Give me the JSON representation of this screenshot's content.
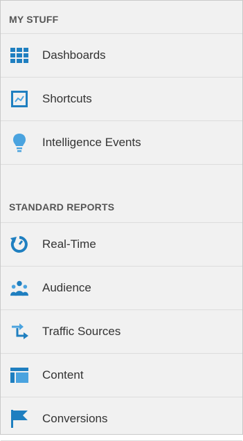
{
  "colors": {
    "accent": "#1f7fc0",
    "icon_light": "#4aa3df"
  },
  "my_stuff": {
    "header": "MY STUFF",
    "items": [
      {
        "label": "Dashboards",
        "icon": "dashboard-grid-icon"
      },
      {
        "label": "Shortcuts",
        "icon": "shortcut-icon"
      },
      {
        "label": "Intelligence Events",
        "icon": "lightbulb-icon"
      }
    ]
  },
  "standard_reports": {
    "header": "STANDARD REPORTS",
    "items": [
      {
        "label": "Real-Time",
        "icon": "realtime-clock-icon"
      },
      {
        "label": "Audience",
        "icon": "audience-people-icon"
      },
      {
        "label": "Traffic Sources",
        "icon": "traffic-arrows-icon"
      },
      {
        "label": "Content",
        "icon": "content-layout-icon"
      },
      {
        "label": "Conversions",
        "icon": "flag-icon"
      }
    ]
  }
}
